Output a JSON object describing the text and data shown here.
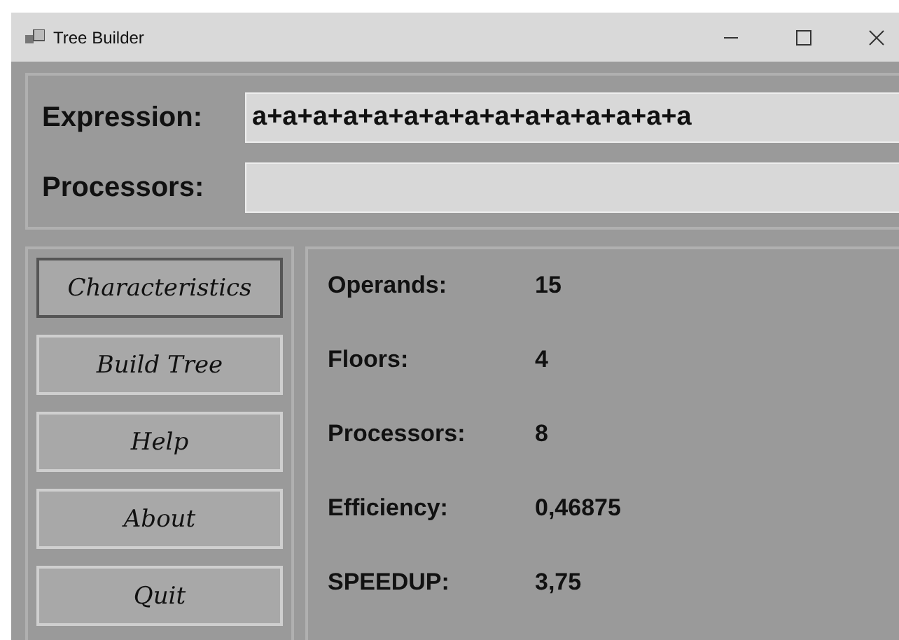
{
  "window": {
    "title": "Tree Builder"
  },
  "inputs": [
    {
      "label": "Expression:",
      "value": "a+a+a+a+a+a+a+a+a+a+a+a+a+a+a"
    },
    {
      "label": "Processors:"
    }
  ],
  "menu": [
    {
      "label": "Characteristics",
      "selected": true
    },
    {
      "label": "Build Tree",
      "selected": false
    },
    {
      "label": "Help",
      "selected": false
    },
    {
      "label": "About",
      "selected": false
    },
    {
      "label": "Quit",
      "selected": false
    }
  ],
  "stats": [
    {
      "label": "Operands:",
      "value": "15"
    },
    {
      "label": "Floors:",
      "value": "4"
    },
    {
      "label": "Processors:",
      "value": "8"
    },
    {
      "label": "Efficiency:",
      "value": "0,46875"
    },
    {
      "label": "SPEEDUP:",
      "value": "3,75"
    }
  ]
}
